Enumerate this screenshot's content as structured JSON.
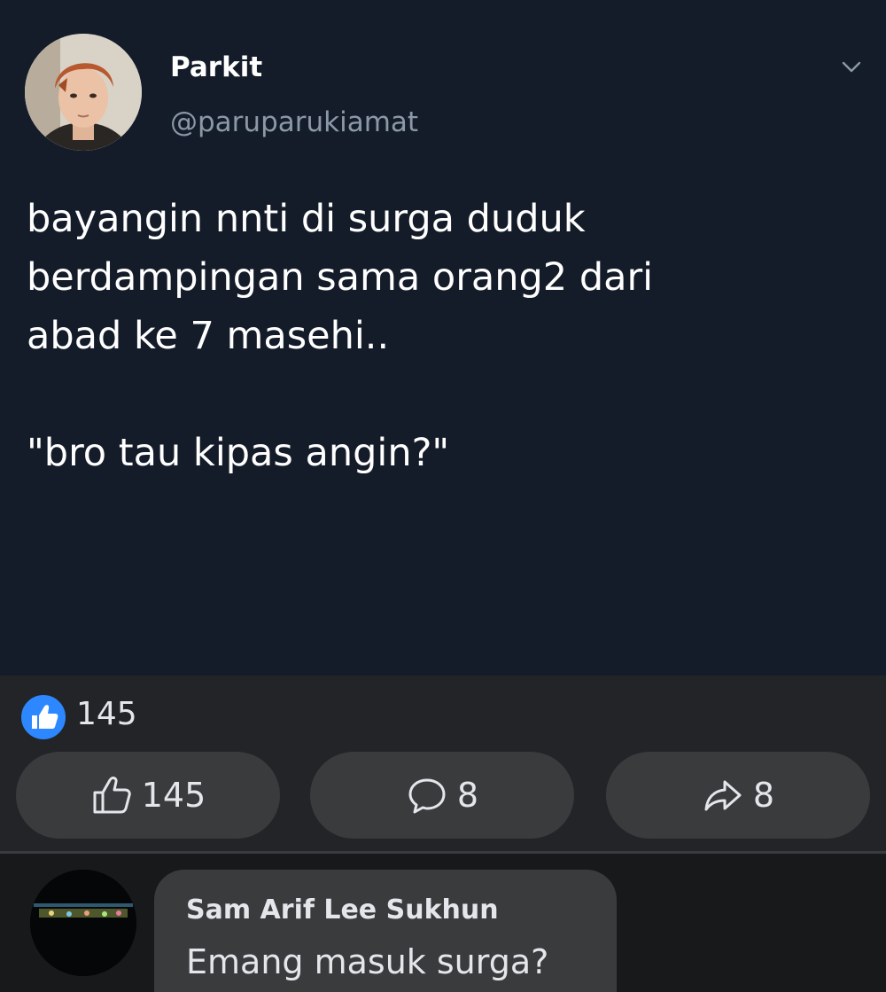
{
  "tweet": {
    "display_name": "Parkit",
    "handle": "@paruparukiamat",
    "text": "bayangin nnti di surga duduk\nberdampingan sama orang2 dari\nabad ke 7 masehi..\n\n\"bro tau kipas angin?\"",
    "avatar_icon": "profile-photo",
    "menu_icon": "chevron-down-icon"
  },
  "reactions": {
    "icon": "like-badge-icon",
    "count": "145"
  },
  "actions": {
    "like": {
      "icon": "thumbs-up-outline-icon",
      "count": "145"
    },
    "comment": {
      "icon": "comment-bubble-icon",
      "count": "8"
    },
    "share": {
      "icon": "share-arrow-icon",
      "count": "8"
    }
  },
  "comment": {
    "author": "Sam Arif Lee Sukhun",
    "text": "Emang masuk surga?",
    "avatar_icon": "commenter-avatar"
  },
  "colors": {
    "tweet_background": "#141c29",
    "fb_background": "#232428",
    "button_background": "#3a3b3c",
    "like_blue": "#2d88ff",
    "handle_gray": "#8b98a6"
  }
}
